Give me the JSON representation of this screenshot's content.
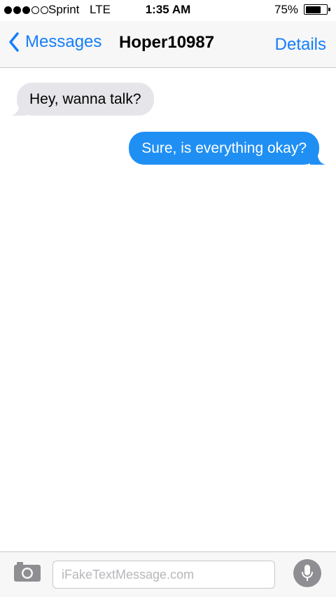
{
  "status_bar": {
    "signal_bars_filled": 3,
    "signal_bars_total": 5,
    "carrier": "Sprint",
    "network": "LTE",
    "time": "1:35 AM",
    "battery_percent": "75%",
    "battery_level": 0.75
  },
  "nav": {
    "back_label": "Messages",
    "title": "Hoper10987",
    "details_label": "Details"
  },
  "messages": [
    {
      "direction": "incoming",
      "text": "Hey, wanna talk?"
    },
    {
      "direction": "outgoing",
      "text": "Sure, is everything okay?"
    }
  ],
  "input": {
    "placeholder": "iFakeTextMessage.com"
  },
  "icons": {
    "back": "chevron-left-icon",
    "camera": "camera-icon",
    "mic": "microphone-icon"
  },
  "colors": {
    "accent": "#157efb",
    "outgoing_bubble": "#1f8ff4",
    "incoming_bubble": "#e5e5ea"
  }
}
